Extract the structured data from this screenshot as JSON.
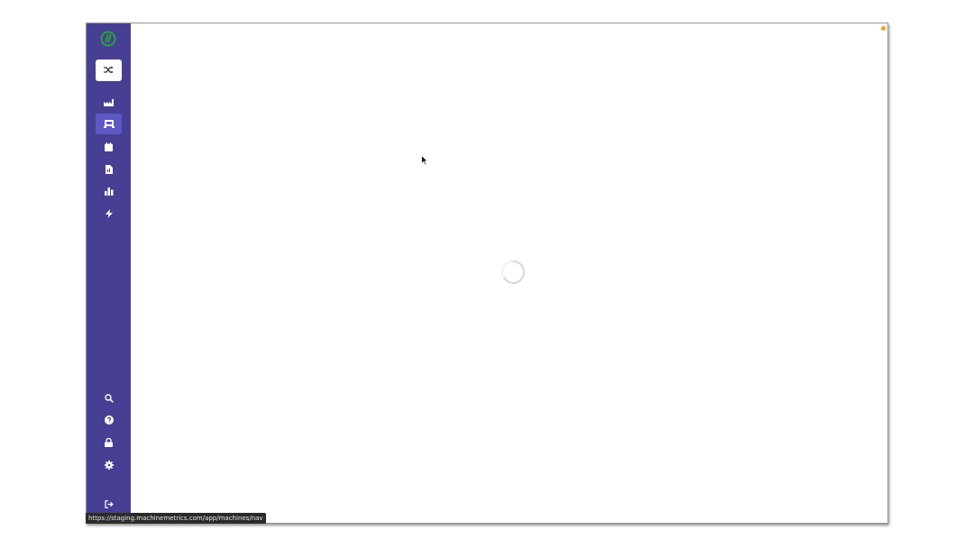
{
  "app": {
    "brand_color": "#463f94",
    "accent_active": "#5d58c4",
    "logo": "machinemetrics-logo"
  },
  "sidebar": {
    "switch_button": {
      "icon": "shuffle-icon"
    },
    "items": [
      {
        "name": "factory",
        "icon": "factory-icon",
        "active": false
      },
      {
        "name": "machines",
        "icon": "machine-icon",
        "active": true
      },
      {
        "name": "calendar",
        "icon": "calendar-icon",
        "active": false
      },
      {
        "name": "reports",
        "icon": "report-icon",
        "active": false
      },
      {
        "name": "charts",
        "icon": "bar-chart-icon",
        "active": false
      },
      {
        "name": "alerts",
        "icon": "bolt-icon",
        "active": false
      }
    ],
    "bottom_items": [
      {
        "name": "search",
        "icon": "search-icon"
      },
      {
        "name": "help",
        "icon": "help-icon"
      },
      {
        "name": "security",
        "icon": "lock-icon"
      },
      {
        "name": "settings",
        "icon": "gear-icon"
      },
      {
        "name": "logout",
        "icon": "logout-icon"
      }
    ]
  },
  "main": {
    "state": "loading",
    "spinner_icon": "loading-spinner-icon"
  },
  "notification": {
    "color": "#f0a018"
  },
  "status_bar": {
    "url": "https://staging.machinemetrics.com/app/machines/nav"
  }
}
